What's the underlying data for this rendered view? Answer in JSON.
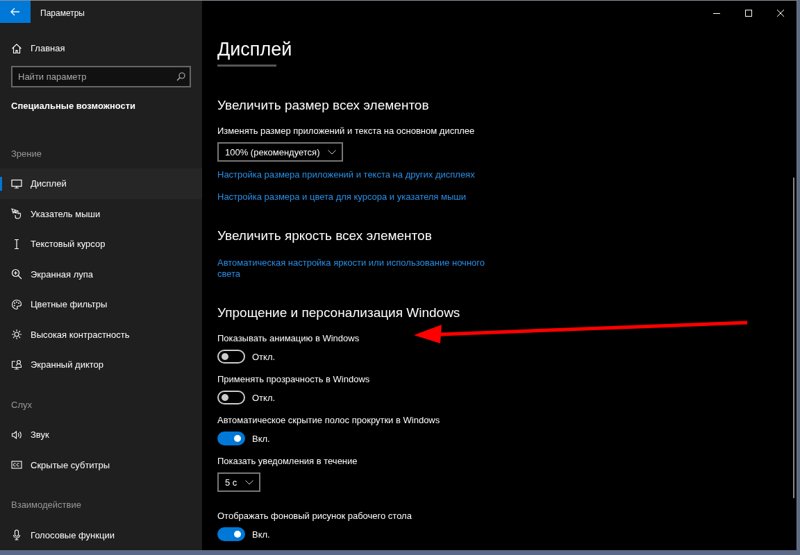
{
  "window": {
    "title": "Параметры"
  },
  "sidebar": {
    "home": "Главная",
    "search": {
      "placeholder": "Найти параметр"
    },
    "category": "Специальные возможности",
    "groups": [
      {
        "heading": "Зрение",
        "items": [
          {
            "label": "Дисплей",
            "selected": true
          },
          {
            "label": "Указатель мыши",
            "selected": false
          },
          {
            "label": "Текстовый курсор",
            "selected": false
          },
          {
            "label": "Экранная лупа",
            "selected": false
          },
          {
            "label": "Цветные фильтры",
            "selected": false
          },
          {
            "label": "Высокая контрастность",
            "selected": false
          },
          {
            "label": "Экранный диктор",
            "selected": false
          }
        ]
      },
      {
        "heading": "Слух",
        "items": [
          {
            "label": "Звук",
            "selected": false
          },
          {
            "label": "Скрытые субтитры",
            "selected": false
          }
        ]
      },
      {
        "heading": "Взаимодействие",
        "items": [
          {
            "label": "Голосовые функции",
            "selected": false
          }
        ]
      }
    ]
  },
  "page": {
    "title": "Дисплей",
    "sections": [
      {
        "heading": "Увеличить размер всех элементов",
        "items": [
          {
            "kind": "label",
            "text": "Изменять размер приложений и текста на основном дисплее"
          },
          {
            "kind": "dropdown",
            "value": "100% (рекомендуется)"
          },
          {
            "kind": "link",
            "text": "Настройка размера приложений и текста на других дисплеях"
          },
          {
            "kind": "link",
            "text": "Настройка размера и цвета для курсора и указателя мыши"
          }
        ]
      },
      {
        "heading": "Увеличить яркость всех элементов",
        "items": [
          {
            "kind": "link",
            "text": "Автоматическая настройка яркости или использование ночного света"
          }
        ]
      },
      {
        "heading": "Упрощение и персонализация Windows",
        "items": [
          {
            "kind": "label",
            "text": "Показывать анимацию в Windows"
          },
          {
            "kind": "toggle",
            "on": false,
            "state": "Откл."
          },
          {
            "kind": "label",
            "text": "Применять прозрачность в Windows"
          },
          {
            "kind": "toggle",
            "on": false,
            "state": "Откл."
          },
          {
            "kind": "label",
            "text": "Автоматическое скрытие полос прокрутки в Windows"
          },
          {
            "kind": "toggle",
            "on": true,
            "state": "Вкл."
          },
          {
            "kind": "label",
            "text": "Показать уведомления в течение"
          },
          {
            "kind": "dropdown",
            "value": "5 с"
          },
          {
            "kind": "label",
            "text": "Отображать фоновый рисунок рабочего стола"
          },
          {
            "kind": "toggle",
            "on": true,
            "state": "Вкл."
          }
        ]
      }
    ]
  }
}
